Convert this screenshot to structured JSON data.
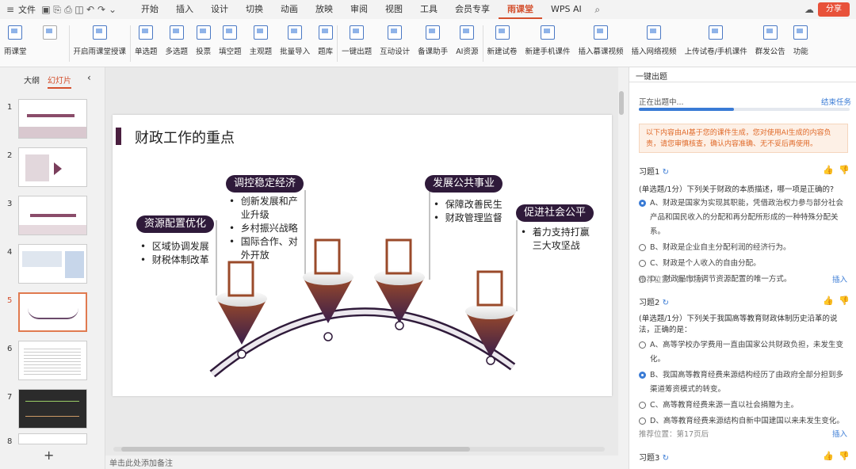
{
  "menu": {
    "file": "文件",
    "tabs": [
      "开始",
      "插入",
      "设计",
      "切换",
      "动画",
      "放映",
      "审阅",
      "视图",
      "工具",
      "会员专享",
      "雨课堂",
      "WPS AI"
    ],
    "active_tab": "雨课堂",
    "share": "分享"
  },
  "ribbon": {
    "items": [
      "雨课堂",
      "开启雨课堂授课",
      "单选题",
      "多选题",
      "投票",
      "填空题",
      "主观题",
      "批量导入",
      "题库",
      "一键出题",
      "互动设计",
      "备课助手",
      "AI资源",
      "新建试卷",
      "新建手机课件",
      "插入慕课视频",
      "插入网络视频",
      "上传试卷/手机课件",
      "群发公告",
      "功能"
    ]
  },
  "left": {
    "tab_outline": "大纲",
    "tab_slides": "幻灯片",
    "slide_numbers": [
      "1",
      "2",
      "3",
      "4",
      "5",
      "6",
      "7",
      "8"
    ],
    "add": "+"
  },
  "slide": {
    "title": "财政工作的重点",
    "b1": {
      "label": "资源配置优化",
      "bullets": [
        "区域协调发展",
        "财税体制改革"
      ]
    },
    "b2": {
      "label": "调控稳定经济",
      "bullets": [
        "创新发展和产业升级",
        "乡村振兴战略",
        "国际合作、对外开放"
      ]
    },
    "b3": {
      "label": "发展公共事业",
      "bullets": [
        "保障改善民生",
        "财政管理监督"
      ]
    },
    "b4": {
      "label": "促进社会公平",
      "bullets": [
        "着力支持打赢三大攻坚战"
      ]
    }
  },
  "notes": "单击此处添加备注",
  "panel": {
    "title": "一键出题",
    "progress_label": "正在出题中...",
    "progress": 0.45,
    "end_task": "结束任务",
    "notice": "以下内容由AI基于您的课件生成，您对使用AI生成的内容负责，请您审慎核查，确认内容准确、无不妥后再使用。",
    "q1": {
      "title": "习题1",
      "stem": "(单选题/1分）下列关于财政的本质描述，哪一项是正确的?",
      "options": [
        "A、财政是国家为实现其职能，凭借政治权力参与部分社会产品和国民收入的分配和再分配所形成的一种特殊分配关系。",
        "B、财政是企业自主分配利润的经济行为。",
        "C、财政是个人收入的自由分配。",
        "D、财政是市场调节资源配置的唯一方式。"
      ],
      "selected": 0,
      "rec": "推荐位置：第4页后",
      "insert": "插入"
    },
    "q2": {
      "title": "习题2",
      "stem": "(单选题/1分）下列关于我国高等教育财政体制历史沿革的说法，正确的是：",
      "options": [
        "A、高等学校办学费用一直由国家公共财政负担，未发生变化。",
        "B、我国高等教育经费来源结构经历了由政府全部分担到多渠道筹资模式的转变。",
        "C、高等教育经费来源一直以社会捐赠为主。",
        "D、高等教育经费来源结构自新中国建国以来未发生变化。"
      ],
      "selected": 1,
      "rec": "推荐位置：第17页后",
      "insert": "插入"
    },
    "q3": {
      "title": "习题3"
    }
  },
  "colors": {
    "accent": "#d4502e",
    "pill": "#2f1a3a",
    "progress": "#3a7bd5"
  }
}
